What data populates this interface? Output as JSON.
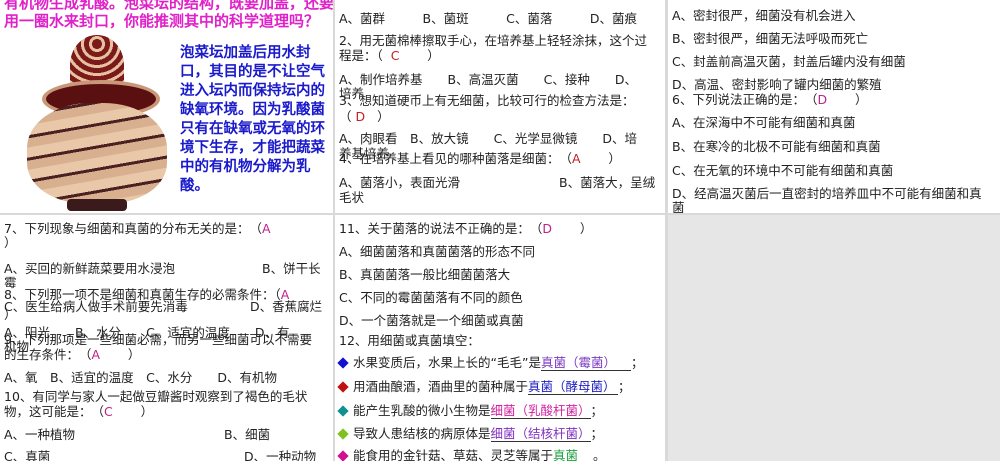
{
  "panel1": {
    "title_lines": [
      "有机物生成乳酸。泡菜坛的结构，既要加盖，还要",
      "用一圈水来封口，你能推测其中的科学道理吗？"
    ],
    "explanation": "泡菜坛加盖后用水封口，其目的是不让空气进入坛内而保持坛内的缺氧环境。因为乳酸菌只有在缺氧或无氧的环境下生存，才能把蔬菜中的有机物分解为乳酸。"
  },
  "panel2": {
    "lines": [
      "A、菌群　　　B、菌斑　　　C、菌落　　　D、菌痕",
      "2、用无菌棉棒擦取手心，在培养基上轻轻涂抹，这个过",
      "程是：（",
      "）",
      "A、制作培养基　　B、高温灭菌　　C、接种　　D、",
      "培养",
      "3、想知道硬币上有无细菌，比较可行的检查方法是：",
      "（",
      "）",
      "A、肉眼看　B、放大镜　　C、光学显微镜　　D、培",
      "养基培养",
      "4、在培养基上看见的哪种菌落是细菌：　（",
      "）",
      "A、菌落小，表面光滑",
      "B、菌落大，呈绒",
      "毛状"
    ],
    "answers": [
      "C",
      "D",
      "A"
    ]
  },
  "panel3": {
    "lines": [
      "A、密封很严，细菌没有机会进入",
      "B、密封很严，细菌无法呼吸而死亡",
      "C、封盖前高温灭菌，封盖后罐内没有细菌",
      "D、高温、密封影响了罐内细菌的繁殖",
      "6、下列说法正确的是：　（",
      "）",
      "A、在深海中不可能有细菌和真菌",
      "B、在寒冷的北极不可能有细菌和真菌",
      "C、在无氧的环境中不可能有细菌和真菌",
      "D、经高温灭菌后一直密封的培养皿中不可能有细菌和真",
      "菌"
    ],
    "answer": "D"
  },
  "panel4": {
    "lines": [
      "7、下列现象与细菌和真菌的分布无关的是：　（",
      "）",
      "A、买回的新鲜蔬菜要用水浸泡",
      "B、饼干长",
      "霉",
      "8、下列那一项不是细菌和真菌生存的必需条件：（",
      "C、医生给病人做手术前要先消毒",
      "D、香蕉腐烂",
      "）",
      "A、阳光　　B、水分　　C、适宜的温度　　D、有",
      "9、下列那项是一些细菌必需，而另一些细菌可以不需要",
      "机物",
      "的生存条件：　（",
      "）",
      "A、氧　B、适宜的温度　C、水分　　D、有机物",
      "10、有同学与家人一起做豆瓣酱时观察到了褐色的毛状",
      "物，这可能是：　（",
      "）",
      "A、一种植物",
      "B、细菌",
      "C、真菌",
      "D、一种动物"
    ],
    "answers": [
      "A",
      "A",
      "A",
      "C"
    ]
  },
  "panel5": {
    "lines": [
      "11、关于菌落的说法不正确的是：　（",
      "）",
      "A、细菌菌落和真菌菌落的形态不同",
      "B、真菌菌落一般比细菌菌落大",
      "C、不同的霉菌菌落有不同的颜色",
      "D、一个菌落就是一个细菌或真菌",
      "12、用细菌或真菌填空："
    ],
    "answer": "D",
    "fills": [
      {
        "text": "水果变质后，水果上长的“毛毛”是",
        "answer": "真菌（霉菌）",
        "end": "；",
        "bullet": "#1010d0",
        "ans_color": "#7a3ac0"
      },
      {
        "text": "用酒曲酿酒，酒曲里的菌种属于",
        "answer": "真菌（酵母菌）",
        "end": "；",
        "bullet": "#c01010",
        "ans_color": "#2020c0"
      },
      {
        "text": "能产生乳酸的微小生物是",
        "answer": "细菌（乳酸杆菌）",
        "end": "；",
        "bullet": "#109090",
        "ans_color": "#d020a0"
      },
      {
        "text": "导致人患结核的病原体是",
        "answer": "细菌（结核杆菌）",
        "end": "；",
        "bullet": "#80c020",
        "ans_color": "#8030c0"
      },
      {
        "text": "能食用的金针菇、草菇、灵芝等属于",
        "answer": "真菌",
        "end": "。",
        "bullet": "#d01090",
        "ans_color": "#20a040"
      }
    ]
  }
}
